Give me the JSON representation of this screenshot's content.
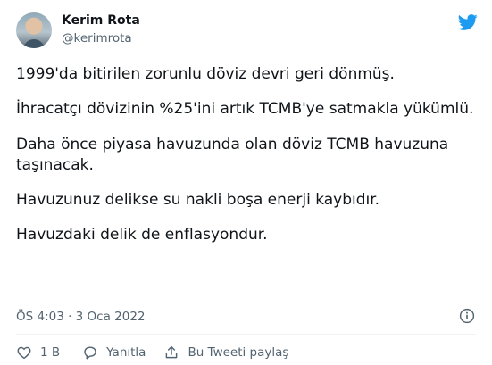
{
  "author": {
    "name": "Kerim Rota",
    "handle": "@kerimrota"
  },
  "tweet": {
    "paragraphs": [
      "1999'da bitirilen zorunlu döviz devri geri dönmüş.",
      "İhracatçı dövizinin %25'ini artık TCMB'ye satmakla yükümlü.",
      "Daha önce piyasa havuzunda olan döviz TCMB havuzuna taşınacak.",
      "Havuzunuz delikse su nakli boşa enerji kaybıdır.",
      "Havuzdaki delik de enflasyondur."
    ],
    "timestamp": "ÖS 4:03 · 3 Oca 2022"
  },
  "actions": {
    "like_count": "1 B",
    "reply_label": "Yanıtla",
    "share_label": "Bu Tweeti paylaş"
  },
  "icons": {
    "brand": "twitter-bird-icon",
    "info": "info-icon",
    "like": "heart-icon",
    "reply": "reply-icon",
    "share": "share-icon"
  },
  "colors": {
    "brand": "#1d9bf0",
    "text": "#0f1419",
    "muted": "#536471"
  }
}
